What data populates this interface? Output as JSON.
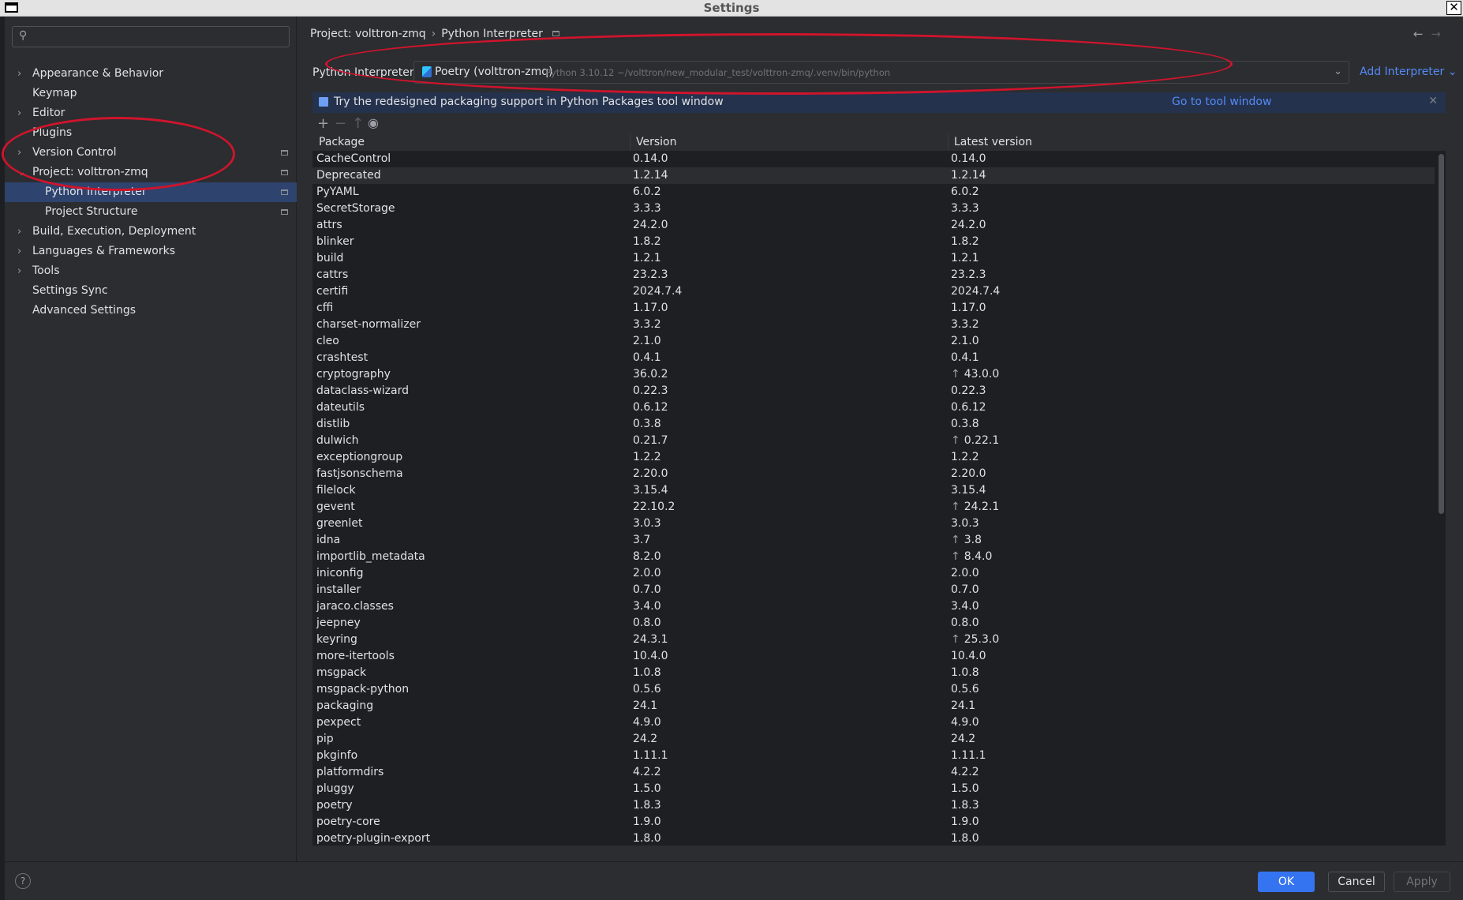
{
  "window": {
    "title": "Settings"
  },
  "sidebar": {
    "search_placeholder": "",
    "items": [
      {
        "label": "Appearance & Behavior",
        "expandable": true,
        "expanded": false
      },
      {
        "label": "Keymap"
      },
      {
        "label": "Editor",
        "expandable": true
      },
      {
        "label": "Plugins"
      },
      {
        "label": "Version Control",
        "expandable": true
      },
      {
        "label": "Project: volttron-zmq",
        "expandable": true,
        "expanded": true
      },
      {
        "label": "Python Interpreter",
        "child": true,
        "selected": true
      },
      {
        "label": "Project Structure",
        "child": true
      },
      {
        "label": "Build, Execution, Deployment",
        "expandable": true
      },
      {
        "label": "Languages & Frameworks",
        "expandable": true
      },
      {
        "label": "Tools",
        "expandable": true
      },
      {
        "label": "Settings Sync"
      },
      {
        "label": "Advanced Settings"
      }
    ]
  },
  "breadcrumb": {
    "project": "Project: volttron-zmq",
    "separator": "›",
    "page": "Python Interpreter"
  },
  "interpreter": {
    "label": "Python Interpreter:",
    "name": "Poetry (volttron-zmq)",
    "path": "Python 3.10.12 ~/volttron/new_modular_test/volttron-zmq/.venv/bin/python",
    "add_label": "Add Interpreter"
  },
  "banner": {
    "text": "Try the redesigned packaging support in Python Packages tool window",
    "link": "Go to tool window"
  },
  "table": {
    "headers": [
      "Package",
      "Version",
      "Latest version"
    ],
    "rows": [
      {
        "package": "CacheControl",
        "version": "0.14.0",
        "latest": "0.14.0"
      },
      {
        "package": "Deprecated",
        "version": "1.2.14",
        "latest": "1.2.14"
      },
      {
        "package": "PyYAML",
        "version": "6.0.2",
        "latest": "6.0.2"
      },
      {
        "package": "SecretStorage",
        "version": "3.3.3",
        "latest": "3.3.3"
      },
      {
        "package": "attrs",
        "version": "24.2.0",
        "latest": "24.2.0"
      },
      {
        "package": "blinker",
        "version": "1.8.2",
        "latest": "1.8.2"
      },
      {
        "package": "build",
        "version": "1.2.1",
        "latest": "1.2.1"
      },
      {
        "package": "cattrs",
        "version": "23.2.3",
        "latest": "23.2.3"
      },
      {
        "package": "certifi",
        "version": "2024.7.4",
        "latest": "2024.7.4"
      },
      {
        "package": "cffi",
        "version": "1.17.0",
        "latest": "1.17.0"
      },
      {
        "package": "charset-normalizer",
        "version": "3.3.2",
        "latest": "3.3.2"
      },
      {
        "package": "cleo",
        "version": "2.1.0",
        "latest": "2.1.0"
      },
      {
        "package": "crashtest",
        "version": "0.4.1",
        "latest": "0.4.1"
      },
      {
        "package": "cryptography",
        "version": "36.0.2",
        "latest": "43.0.0",
        "upgrade": true
      },
      {
        "package": "dataclass-wizard",
        "version": "0.22.3",
        "latest": "0.22.3"
      },
      {
        "package": "dateutils",
        "version": "0.6.12",
        "latest": "0.6.12"
      },
      {
        "package": "distlib",
        "version": "0.3.8",
        "latest": "0.3.8"
      },
      {
        "package": "dulwich",
        "version": "0.21.7",
        "latest": "0.22.1",
        "upgrade": true
      },
      {
        "package": "exceptiongroup",
        "version": "1.2.2",
        "latest": "1.2.2"
      },
      {
        "package": "fastjsonschema",
        "version": "2.20.0",
        "latest": "2.20.0"
      },
      {
        "package": "filelock",
        "version": "3.15.4",
        "latest": "3.15.4"
      },
      {
        "package": "gevent",
        "version": "22.10.2",
        "latest": "24.2.1",
        "upgrade": true
      },
      {
        "package": "greenlet",
        "version": "3.0.3",
        "latest": "3.0.3"
      },
      {
        "package": "idna",
        "version": "3.7",
        "latest": "3.8",
        "upgrade": true
      },
      {
        "package": "importlib_metadata",
        "version": "8.2.0",
        "latest": "8.4.0",
        "upgrade": true
      },
      {
        "package": "iniconfig",
        "version": "2.0.0",
        "latest": "2.0.0"
      },
      {
        "package": "installer",
        "version": "0.7.0",
        "latest": "0.7.0"
      },
      {
        "package": "jaraco.classes",
        "version": "3.4.0",
        "latest": "3.4.0"
      },
      {
        "package": "jeepney",
        "version": "0.8.0",
        "latest": "0.8.0"
      },
      {
        "package": "keyring",
        "version": "24.3.1",
        "latest": "25.3.0",
        "upgrade": true
      },
      {
        "package": "more-itertools",
        "version": "10.4.0",
        "latest": "10.4.0"
      },
      {
        "package": "msgpack",
        "version": "1.0.8",
        "latest": "1.0.8"
      },
      {
        "package": "msgpack-python",
        "version": "0.5.6",
        "latest": "0.5.6"
      },
      {
        "package": "packaging",
        "version": "24.1",
        "latest": "24.1"
      },
      {
        "package": "pexpect",
        "version": "4.9.0",
        "latest": "4.9.0"
      },
      {
        "package": "pip",
        "version": "24.2",
        "latest": "24.2"
      },
      {
        "package": "pkginfo",
        "version": "1.11.1",
        "latest": "1.11.1"
      },
      {
        "package": "platformdirs",
        "version": "4.2.2",
        "latest": "4.2.2"
      },
      {
        "package": "pluggy",
        "version": "1.5.0",
        "latest": "1.5.0"
      },
      {
        "package": "poetry",
        "version": "1.8.3",
        "latest": "1.8.3"
      },
      {
        "package": "poetry-core",
        "version": "1.9.0",
        "latest": "1.9.0"
      },
      {
        "package": "poetry-plugin-export",
        "version": "1.8.0",
        "latest": "1.8.0"
      }
    ]
  },
  "buttons": {
    "help": "?",
    "ok": "OK",
    "cancel": "Cancel",
    "apply": "Apply"
  },
  "colors": {
    "accent": "#3574f0",
    "selection": "#2e436e",
    "annotation": "#d0142c"
  }
}
